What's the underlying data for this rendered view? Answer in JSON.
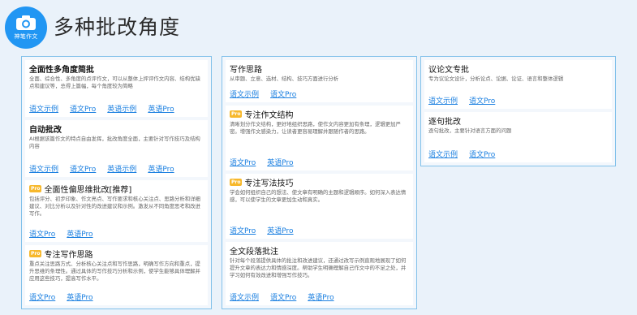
{
  "header": {
    "logo_text": "神笔作文",
    "title": "多种批改角度"
  },
  "cards": {
    "c1": {
      "title": "全面性多角度简批",
      "desc": "全面、综合性、多角度的点评作文，可以从整体上抨评作文内容、结构优缺点和建议等，总得上篇幅，每个角度较为简略",
      "links": [
        "语文示例",
        "语文Pro",
        "英语示例",
        "英语Pro"
      ]
    },
    "c2": {
      "title": "自动批改",
      "desc": "AI根据该篇作文的特点自由发挥，批改角度全面，主要针对写作技巧及结构内容",
      "links": [
        "语文示例",
        "语文Pro",
        "英语示例",
        "英语Pro"
      ]
    },
    "c3": {
      "badge": "Pro",
      "title": "全面性偏思维批改[推荐]",
      "desc": "包括评分、初步印象、作文亮点、写作要求和核心关注点、思路分析和详细建议、对比分析以及针对性的改进建议和示例。激发从不同角度思考和改进写作。",
      "links": [
        "语文Pro",
        "英语Pro"
      ]
    },
    "c4": {
      "badge": "Pro",
      "title": "专注写作思路",
      "desc": "重点关注思路方式、分析核心关注点和写作思路，明确写作方向和重点，提升思维的条理性。通过具体的写作技巧分析和示例，使学生能够具体理解并应用这些技巧，提高写作水平。",
      "links": [
        "语文Pro",
        "英语Pro"
      ]
    },
    "c5": {
      "title": "写作思路",
      "desc": "从审题、立意、选材、结构、技巧方面进行分析",
      "links": [
        "语文示例",
        "语文Pro"
      ]
    },
    "c6": {
      "badge": "Pro",
      "title": "专注作文结构",
      "desc": "清晰划分作文结构，更好地组织思路，使作文内容更加有条理，逻辑更加严密。增强作文感染力，让读者更容易理解并跟随作者的思路。",
      "links": [
        "语文Pro",
        "英语Pro"
      ]
    },
    "c7": {
      "badge": "Pro",
      "title": "专注写法技巧",
      "desc": "学会如何组织自己的想法、使文章有明确的主题和逻辑顺序。如何深入表达情感，可以使学生的文章更加生动和真实。",
      "links": [
        "语文Pro",
        "英语Pro"
      ]
    },
    "c8": {
      "title": "全文段落批注",
      "desc": "针对每个段落提供具体的批注和改进建议，还通过改写示例直观地展现了如何提升文章的表达力和情感深度。帮助学生明确理解自己作文中的不足之处，并学习如何有效改进和增强写作技巧。",
      "links": [
        "语文示例",
        "语文Pro",
        "英语Pro"
      ]
    },
    "c9": {
      "title": "议论文专批",
      "desc": "专为议论文设计，分析论点、论据、论证、语言和整体逻辑",
      "links": [
        "语文示例",
        "语文Pro"
      ]
    },
    "c10": {
      "title": "逐句批改",
      "desc": "逐句批改，主要针对语言方面的问题",
      "links": [
        "语文示例",
        "语文Pro"
      ]
    }
  }
}
